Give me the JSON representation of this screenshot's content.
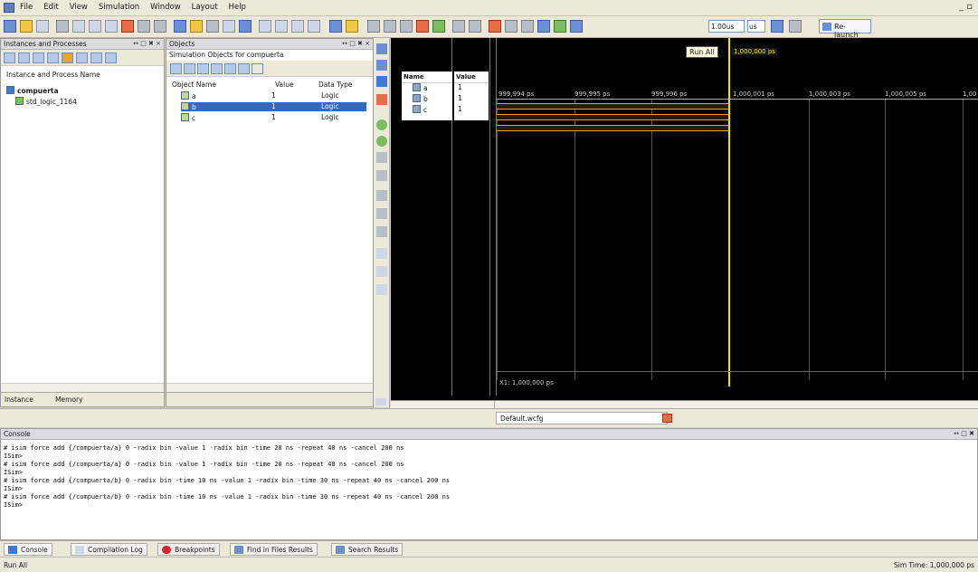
{
  "menu": [
    "File",
    "Edit",
    "View",
    "Simulation",
    "Window",
    "Layout",
    "Help"
  ],
  "toolbar": {
    "run_all_tooltip": "Run All",
    "run_time_value": "1.00us",
    "run_time_unit": "us",
    "relaunch_label": "Re-launch"
  },
  "instances_panel": {
    "title": "Instances and Processes",
    "col_header": "Instance and Process Name",
    "items": [
      {
        "label": "compuerta",
        "bold": true
      },
      {
        "label": "std_logic_1164"
      }
    ],
    "tabs": [
      "Instance",
      "Memory"
    ]
  },
  "objects_panel": {
    "title": "Objects",
    "subtitle": "Simulation Objects for compuerta",
    "columns": [
      "Object Name",
      "Value",
      "Data Type"
    ],
    "rows": [
      {
        "name": "a",
        "value": "1",
        "type": "Logic"
      },
      {
        "name": "b",
        "value": "1",
        "type": "Logic",
        "selected": true
      },
      {
        "name": "c",
        "value": "1",
        "type": "Logic"
      }
    ]
  },
  "waveform": {
    "name_header": "Name",
    "value_header": "Value",
    "signals": [
      {
        "name": "a",
        "value": "1"
      },
      {
        "name": "b",
        "value": "1"
      },
      {
        "name": "c",
        "value": "1"
      }
    ],
    "time_ticks": [
      "999,994 ps",
      "999,995 ps",
      "999,996 ps",
      "1,000,001 ps",
      "1,000,003 ps",
      "1,000,005 ps",
      "1,00"
    ],
    "cursor_label": "1,000,000 ps",
    "cursor_readout": "X1: 1,000,000 ps",
    "file_tab": "Default.wcfg"
  },
  "console": {
    "title": "Console",
    "lines": [
      "# isim force add {/compuerta/a} 0 -radix bin -value 1 -radix bin -time 20 ns -repeat 40 ns -cancel 200 ns",
      "ISim>",
      "# isim force add {/compuerta/a} 0 -radix bin -value 1 -radix bin -time 20 ns -repeat 40 ns -cancel 200 ns",
      "ISim>",
      "# isim force add {/compuerta/b} 0 -radix bin -time 10 ns -value 1 -radix bin -time 30 ns -repeat 40 ns -cancel 200 ns",
      "ISim>",
      "# isim force add {/compuerta/b} 0 -radix bin -time 10 ns -value 1 -radix bin -time 30 ns -repeat 40 ns -cancel 200 ns",
      "ISim>"
    ]
  },
  "bottom_tabs": [
    "Console",
    "Compilation Log",
    "Breakpoints",
    "Find in Files Results",
    "Search Results"
  ],
  "status": {
    "left": "Run All",
    "right": "Sim Time: 1,000,000 ps"
  },
  "colors": {
    "waveform_bg": "#000000",
    "signal_high": "#e6a531",
    "cursor": "#f2e600",
    "selection": "#316ac5"
  }
}
